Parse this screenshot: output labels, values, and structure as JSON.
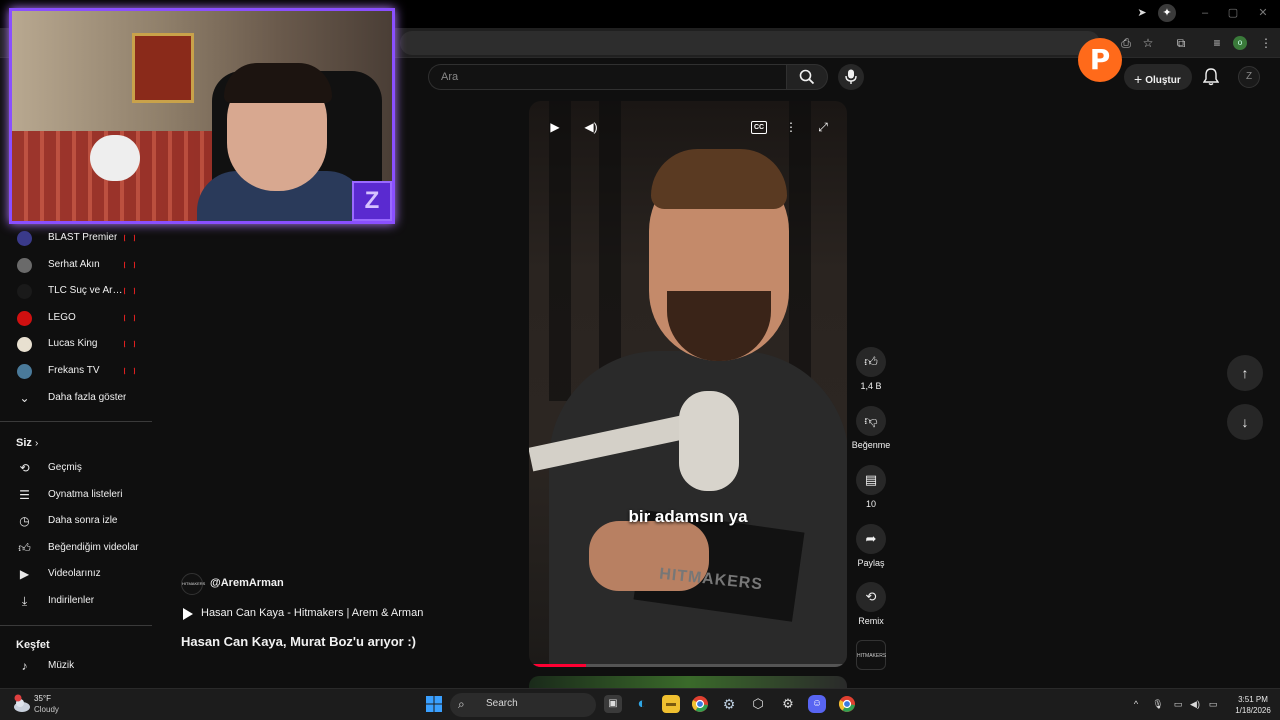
{
  "search": {
    "placeholder": "Ara"
  },
  "header": {
    "create_label": "Oluştur",
    "avatar_letter": "Z"
  },
  "overlay_badge": "P",
  "sidebar": {
    "subscriptions": [
      {
        "label": "BLAST Premier",
        "color": "#3a3a8a"
      },
      {
        "label": "Serhat Akın",
        "color": "#6a6a6a"
      },
      {
        "label": "TLC Suç ve Araştırma",
        "color": "#1a1a1a"
      },
      {
        "label": "LEGO",
        "color": "#d01010"
      },
      {
        "label": "Lucas King",
        "color": "#e8e0d0"
      },
      {
        "label": "Frekans TV",
        "color": "#4a7a9a"
      }
    ],
    "show_more": "Daha fazla göster",
    "you_heading": "Siz",
    "you_items": [
      {
        "label": "Geçmiş",
        "icon": "history-icon"
      },
      {
        "label": "Oynatma listeleri",
        "icon": "playlists-icon"
      },
      {
        "label": "Daha sonra izle",
        "icon": "watch-later-icon"
      },
      {
        "label": "Beğendiğim videolar",
        "icon": "liked-videos-icon"
      },
      {
        "label": "Videolarınız",
        "icon": "your-videos-icon"
      },
      {
        "label": "İndirilenler",
        "icon": "downloads-icon"
      }
    ],
    "explore_heading": "Keşfet",
    "explore_items": [
      {
        "label": "Müzik",
        "icon": "music-icon"
      }
    ]
  },
  "video": {
    "channel_handle": "@AremArman",
    "playlist_title": "Hasan Can Kaya - Hitmakers | Arem & Arman",
    "title": "Hasan Can Kaya, Murat Boz'u arıyor :)",
    "caption": "bir adamsın ya",
    "board_text": "HITMAKERS",
    "progress": 0.18
  },
  "actions": {
    "likes": "1,4 B",
    "dislike": "Beğenme",
    "comments": "10",
    "share": "Paylaş",
    "remix": "Remix"
  },
  "taskbar": {
    "temp": "35°F",
    "weather": "Cloudy",
    "search": "Search",
    "time": "3:51 PM",
    "date": "1/18/2026"
  }
}
